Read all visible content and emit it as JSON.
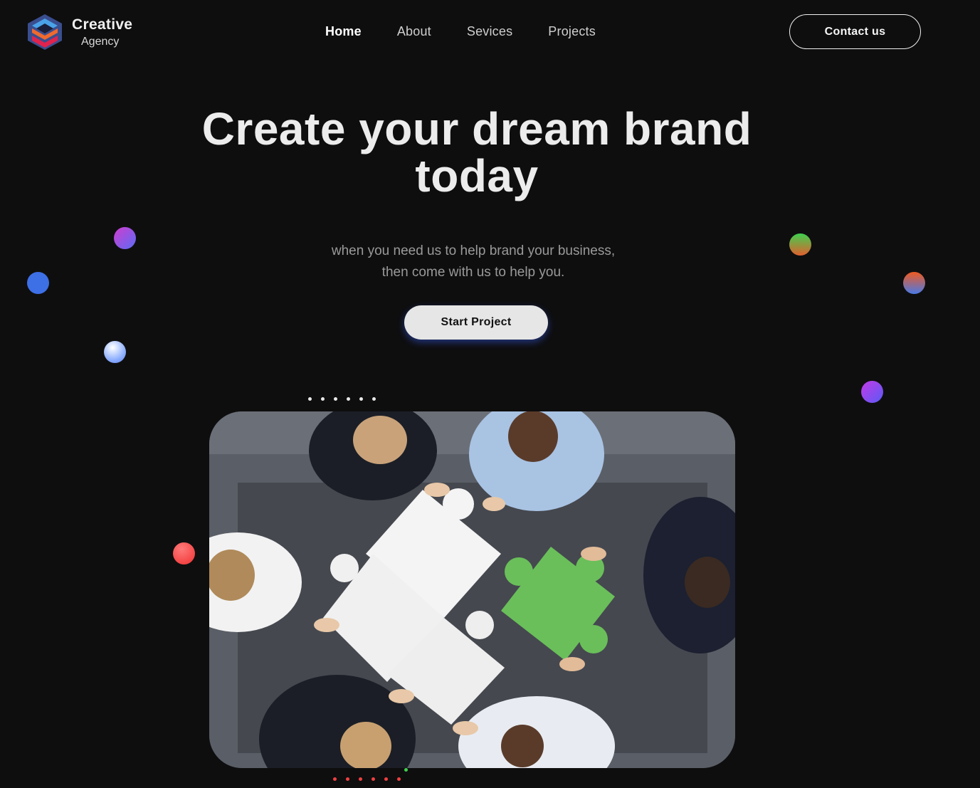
{
  "brand": {
    "name": "Creative",
    "tagline": "Agency",
    "colors": {
      "top": "#4a8fe0",
      "middle": "#f06a2e",
      "bottom": "#e0234e"
    }
  },
  "nav": {
    "items": [
      {
        "label": "Home",
        "active": true
      },
      {
        "label": "About",
        "active": false
      },
      {
        "label": "Sevices",
        "active": false
      },
      {
        "label": "Projects",
        "active": false
      }
    ]
  },
  "header": {
    "contact_label": "Contact us"
  },
  "hero": {
    "title_line1": "Create your dream brand",
    "title_line2": "today",
    "subtitle_line1": "when you need us to help brand your business,",
    "subtitle_line2": "then come with us to help you.",
    "cta_label": "Start Project"
  },
  "image": {
    "icon": "team-puzzle-image"
  },
  "colors": {
    "background": "#0e0e0f",
    "accent_blue": "#3d6fe6",
    "accent_green": "#3fcf4f",
    "accent_red": "#f04040"
  }
}
